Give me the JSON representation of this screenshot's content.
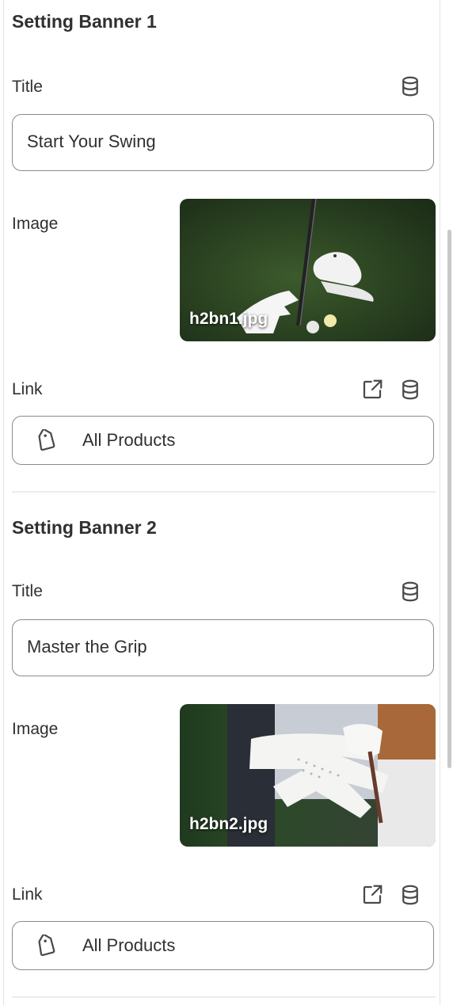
{
  "banners": [
    {
      "heading": "Setting Banner 1",
      "title_label": "Title",
      "title_value": "Start Your Swing",
      "image_label": "Image",
      "image_filename": "h2bn1.jpg",
      "link_label": "Link",
      "link_value": "All Products"
    },
    {
      "heading": "Setting Banner 2",
      "title_label": "Title",
      "title_value": "Master the Grip",
      "image_label": "Image",
      "image_filename": "h2bn2.jpg",
      "link_label": "Link",
      "link_value": "All Products"
    }
  ],
  "icons": {
    "dynamic_source": "database-icon",
    "open_link": "external-link-icon",
    "link_type": "tag-icon"
  },
  "colors": {
    "text": "#303030",
    "border": "#8a8a8a",
    "divider": "#ececec"
  }
}
